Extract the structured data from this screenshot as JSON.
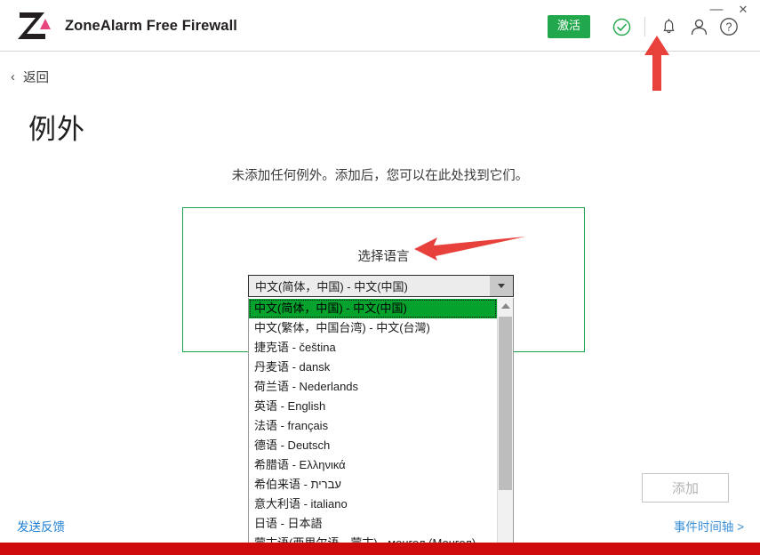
{
  "window": {
    "minimize_label": "—",
    "close_label": "✕"
  },
  "header": {
    "app_title": "ZoneAlarm Free Firewall",
    "logo_letter": "Z",
    "activate_label": "激活",
    "icons": {
      "status_check": "check-circle-icon",
      "notifications": "bell-icon",
      "account": "person-icon",
      "help": "help-circle-icon"
    }
  },
  "nav": {
    "back_label": "返回",
    "back_chevron": "‹"
  },
  "page": {
    "title": "例外",
    "empty_message": "未添加任何例外。添加后，您可以在此处找到它们。"
  },
  "language_selector": {
    "label": "选择语言",
    "selected_value": "中文(简体，中国) - 中文(中国)",
    "options": [
      "中文(简体，中国) - 中文(中国)",
      "中文(繁体，中国台湾) - 中文(台灣)",
      "捷克语 - čeština",
      "丹麦语 - dansk",
      "荷兰语 - Nederlands",
      "英语 - English",
      "法语 - français",
      "德语 - Deutsch",
      "希腊语 - Ελληνικά",
      "希伯来语 - עברית",
      "意大利语 - italiano",
      "日语 - 日本語",
      "蒙古语(西里尔语、蒙古) - монгол (Монгол)"
    ],
    "selected_index": 0
  },
  "footer": {
    "feedback_label": "发送反馈",
    "add_button_label": "添加",
    "timeline_label": "事件时间轴 >"
  },
  "colors": {
    "brand_black": "#231f20",
    "brand_pink": "#e8447e",
    "activate_green": "#21a84c",
    "highlight_green": "#1aa34a",
    "selection_green": "#05a22d",
    "link_blue": "#1d7fd4",
    "annotation_red": "#e8413c",
    "bottom_bar_red": "#cf0a0a"
  }
}
